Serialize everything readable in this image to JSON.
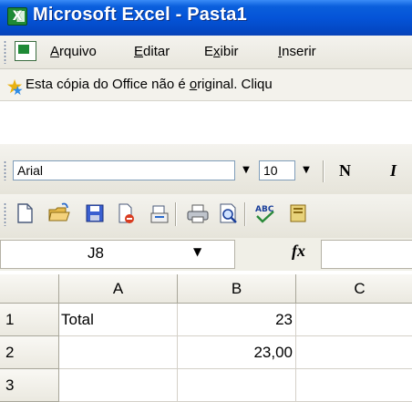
{
  "window": {
    "title": "Microsoft Excel - Pasta1",
    "app_icon_glyph": "X"
  },
  "menubar": {
    "items": [
      {
        "label": "Arquivo",
        "accel": "A",
        "rest": "rquivo"
      },
      {
        "label": "Editar",
        "accel": "E",
        "rest": "ditar"
      },
      {
        "label": "Exibir",
        "pre": "E",
        "accel": "x",
        "rest": "ibir"
      },
      {
        "label": "Inserir",
        "accel": "I",
        "rest": "nserir"
      }
    ]
  },
  "infobar": {
    "text_pre": "Esta cópia do Office não é ",
    "text_accel": "o",
    "text_post": "riginal.  Cliqu"
  },
  "formatting": {
    "font": "Arial",
    "size": "10",
    "bold_label": "N",
    "italic_label": "I"
  },
  "formula_bar": {
    "name_box": "J8",
    "fx_label": "fx",
    "formula": ""
  },
  "sheet": {
    "column_headers": [
      "A",
      "B",
      "C"
    ],
    "rows": [
      {
        "num": "1",
        "cells": [
          "Total",
          "23",
          ""
        ]
      },
      {
        "num": "2",
        "cells": [
          "",
          "23,00",
          ""
        ]
      },
      {
        "num": "3",
        "cells": [
          "",
          "",
          ""
        ]
      }
    ]
  },
  "colors": {
    "titlebar": "#0554d8",
    "toolbar_bg": "#ece9d8",
    "gridline": "#d4d0c8",
    "header_bg": "#ebe9e0"
  },
  "icons": {
    "std_toolbar": [
      "new-document-icon",
      "open-folder-icon",
      "save-icon",
      "permission-icon",
      "email-icon",
      "print-icon",
      "print-preview-icon",
      "spelling-icon",
      "research-icon"
    ]
  }
}
